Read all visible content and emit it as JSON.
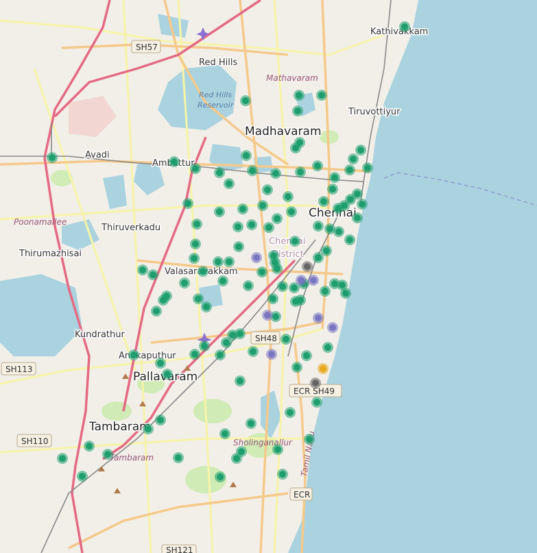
{
  "map": {
    "places": [
      {
        "id": "kathivakkam",
        "name": "Kathivakkam",
        "size": "med"
      },
      {
        "id": "red-hills",
        "name": "Red Hills",
        "size": "med"
      },
      {
        "id": "mathavaram",
        "name": "Mathavaram",
        "size": "area"
      },
      {
        "id": "red-hills-reservoir",
        "name": "Red Hills\nReservoir",
        "size": "water"
      },
      {
        "id": "tiruvottiyur",
        "name": "Tiruvottiyur",
        "size": "med"
      },
      {
        "id": "madhavaram",
        "name": "Madhavaram",
        "size": "big"
      },
      {
        "id": "avadi",
        "name": "Avadi",
        "size": "med"
      },
      {
        "id": "ambattur",
        "name": "Ambattur",
        "size": "med"
      },
      {
        "id": "chennai",
        "name": "Chennai",
        "size": "big"
      },
      {
        "id": "poonamallee",
        "name": "Poonamallee",
        "size": "area"
      },
      {
        "id": "thiruverkadu",
        "name": "Thiruverkadu",
        "size": "med"
      },
      {
        "id": "chennai-district",
        "name": "Chennai\nDistrict",
        "size": "dist"
      },
      {
        "id": "thirumazhisai",
        "name": "Thirumazhisai",
        "size": "med"
      },
      {
        "id": "valasaravakkam",
        "name": "Valasaravakkam",
        "size": "med"
      },
      {
        "id": "kundrathur",
        "name": "Kundrathur",
        "size": "med"
      },
      {
        "id": "anakaputhur",
        "name": "Anakaputhur",
        "size": "med"
      },
      {
        "id": "pallavaram",
        "name": "Pallavaram",
        "size": "big"
      },
      {
        "id": "tambaram",
        "name": "Tambaram",
        "size": "big"
      },
      {
        "id": "tambaram-area",
        "name": "Tambaram",
        "size": "area"
      },
      {
        "id": "sholinganallur",
        "name": "Sholinganallur",
        "size": "area"
      },
      {
        "id": "tamil-nadu",
        "name": "Tamil Nadu",
        "size": "area"
      }
    ],
    "shields": [
      {
        "id": "sh57",
        "text": "SH57"
      },
      {
        "id": "sh48",
        "text": "SH48"
      },
      {
        "id": "ecr-sh49",
        "text": "ECR SH49"
      },
      {
        "id": "sh113",
        "text": "SH113"
      },
      {
        "id": "sh110",
        "text": "SH110"
      },
      {
        "id": "ecr",
        "text": "ECR"
      },
      {
        "id": "sh121",
        "text": "SH121"
      }
    ],
    "marker_colors": {
      "green": "#1e9e6e",
      "purple": "#7a76c2",
      "gray": "#666666",
      "yellow": "#e8a81c"
    },
    "colors": {
      "sea": "#aad3df",
      "land": "#f2efe9",
      "lake": "#aad3df",
      "road_major": "#e46a84",
      "road_primary": "#f5c98a",
      "road_secondary": "#f7f4a8",
      "railway": "#888888",
      "park": "#cdebb0"
    }
  }
}
